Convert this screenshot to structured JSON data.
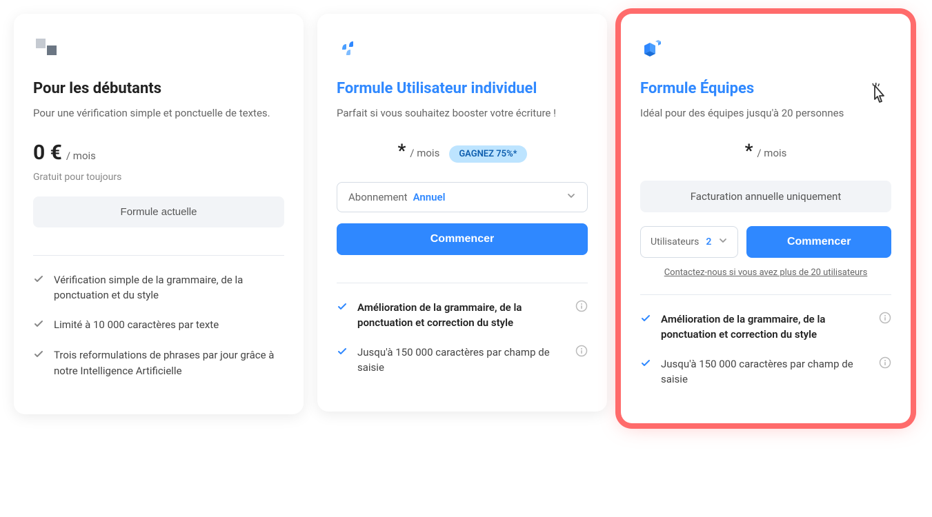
{
  "plans": {
    "beginner": {
      "title": "Pour les débutants",
      "subtitle": "Pour une vérification simple et ponctuelle de textes.",
      "price": "0 €",
      "period": "/ mois",
      "sub_note": "Gratuit pour toujours",
      "button_label": "Formule actuelle",
      "features": [
        "Vérification simple de la grammaire, de la ponctuation et du style",
        "Limité à 10 000 caractères par texte",
        "Trois reformulations de phrases par jour grâce à notre Intelligence Artificielle"
      ]
    },
    "individual": {
      "title": "Formule Utilisateur individuel",
      "subtitle": "Parfait si vous souhaitez booster votre écriture !",
      "price": "*",
      "period": "/ mois",
      "badge": "GAGNEZ 75%*",
      "subscription_label": "Abonnement",
      "subscription_value": "Annuel",
      "button_label": "Commencer",
      "features": [
        {
          "text": "Amélioration de la grammaire, de la ponctuation et correction du style",
          "bold": true,
          "info": true
        },
        {
          "text": "Jusqu'à 150 000 caractères par champ de saisie",
          "bold": false,
          "info": true
        }
      ]
    },
    "teams": {
      "title": "Formule Équipes",
      "subtitle": "Idéal pour des équipes jusqu'à 20 personnes",
      "price": "*",
      "period": "/ mois",
      "billing_note": "Facturation annuelle uniquement",
      "users_label": "Utilisateurs",
      "users_value": "2",
      "button_label": "Commencer",
      "contact_link": "Contactez-nous si vous avez plus de 20 utilisateurs",
      "features": [
        {
          "text": "Amélioration de la grammaire, de la ponctuation et correction du style",
          "bold": true,
          "info": true
        },
        {
          "text": "Jusqu'à 150 000 caractères par champ de saisie",
          "bold": false,
          "info": true
        }
      ]
    }
  }
}
